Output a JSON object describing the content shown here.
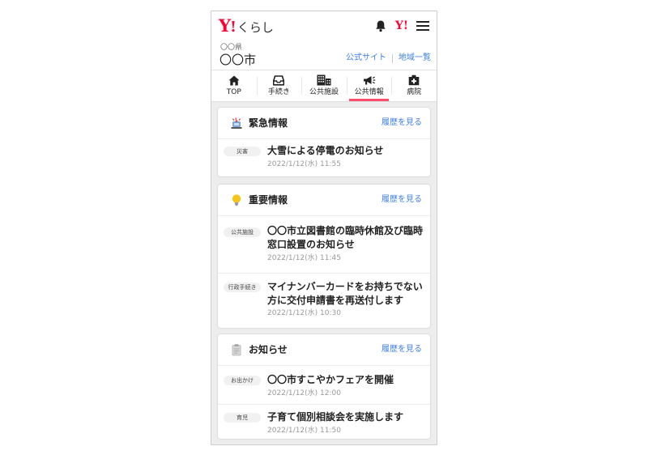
{
  "header": {
    "logo_mark": "Y",
    "logo_bang": "!",
    "logo_text": "くらし",
    "ymark": "Y!"
  },
  "location": {
    "prefecture": "〇〇県",
    "city": "〇〇市",
    "official_site": "公式サイト",
    "region_list": "地域一覧"
  },
  "nav": [
    {
      "label": "TOP",
      "icon": "home-icon",
      "active": false
    },
    {
      "label": "手続き",
      "icon": "inbox-tray-icon",
      "active": false
    },
    {
      "label": "公共施設",
      "icon": "building-icon",
      "active": false
    },
    {
      "label": "公共情報",
      "icon": "megaphone-icon",
      "active": true
    },
    {
      "label": "病院",
      "icon": "hospital-icon",
      "active": false
    }
  ],
  "sections": {
    "emergency": {
      "title": "緊急情報",
      "more": "履歴を見る",
      "icon": "emergency-siren-icon",
      "items": [
        {
          "tag": "災害",
          "title": "大雪による停電のお知らせ",
          "date": "2022/1/12(水) 11:55"
        }
      ]
    },
    "important": {
      "title": "重要情報",
      "more": "履歴を見る",
      "icon": "lightbulb-icon",
      "items": [
        {
          "tag": "公共施設",
          "title": "〇〇市立図書館の臨時休館及び臨時窓口設置のお知らせ",
          "date": "2022/1/12(水) 11:45"
        },
        {
          "tag": "行政手続き",
          "title": "マイナンバーカードをお持ちでない方に交付申請書を再送付します",
          "date": "2022/1/12(水) 10:30"
        }
      ]
    },
    "notice": {
      "title": "お知らせ",
      "more": "履歴を見る",
      "icon": "clipboard-icon",
      "items": [
        {
          "tag": "お出かけ",
          "title": "〇〇市すこやかフェアを開催",
          "date": "2022/1/12(水) 12:00"
        },
        {
          "tag": "育児",
          "title": "子育て個別相談会を実施します",
          "date": "2022/1/12(水) 11:50"
        }
      ]
    }
  },
  "colors": {
    "brand_red": "#ff0033",
    "link_blue": "#3d7ee8",
    "active_tab": "#ff4b6e"
  }
}
